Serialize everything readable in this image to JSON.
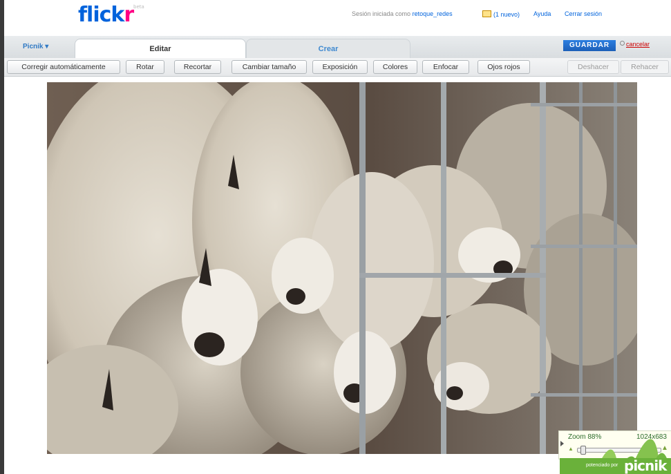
{
  "flickr": {
    "logo_main": "flick",
    "logo_accent": "r",
    "logo_beta": "beta",
    "session_prefix": "Sesión iniciada como",
    "username": "retoque_redes",
    "inbox": "(1 nuevo)",
    "help": "Ayuda",
    "logout": "Cerrar sesión"
  },
  "picnik": {
    "menu": "Picnik ▾",
    "tabs": [
      {
        "label": "Editar",
        "active": true
      },
      {
        "label": "Crear",
        "active": false
      }
    ],
    "save": "GUARDAR",
    "cancel": "cancelar"
  },
  "toolbar": {
    "tools": [
      "Corregir automáticamente",
      "Rotar",
      "Recortar",
      "Cambiar tamaño",
      "Exposición",
      "Colores",
      "Enfocar",
      "Ojos rojos"
    ],
    "undo": "Deshacer",
    "redo": "Rehacer"
  },
  "zoom": {
    "label": "Zoom 88%",
    "dimensions": "1024x683",
    "level_percent": 88
  },
  "footer": {
    "powered_by": "potenciado por",
    "brand": "picnik"
  },
  "colors": {
    "flickr_blue": "#0063dc",
    "flickr_pink": "#ff0084",
    "save_blue": "#1c5fb8",
    "link_red": "#cc0000"
  }
}
